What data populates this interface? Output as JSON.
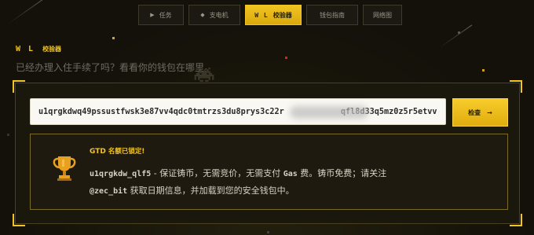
{
  "nav": {
    "tabs": [
      {
        "label": "任务",
        "icon": "▶",
        "active": false
      },
      {
        "label": "支电机",
        "icon": "◆",
        "active": false
      },
      {
        "label": "校验器",
        "icon": "W L",
        "active": true
      },
      {
        "label": "钱包指南",
        "icon": "",
        "active": false
      },
      {
        "label": "网络图",
        "icon": "",
        "active": false
      }
    ]
  },
  "brand": {
    "logo": "W L",
    "title": "校验器"
  },
  "question": "已经办理入住手续了吗？看看你的钱包在哪里。",
  "address": {
    "part1": "u1qrgkdwq49pssustfwsk3e87vv4qdc0tmtrzs3du8prys3c22r",
    "part2": "qfl8d33q5mz0z5r5etvv"
  },
  "check_button": {
    "label": "检查",
    "arrow": "→"
  },
  "notice": {
    "title_badge": "GTD",
    "title": "名额已锁定!",
    "handle": "u1qrgkdw_qlf5",
    "line1": " - 保证铸币，无需竞价，无需支付 ",
    "gas": "Gas",
    "line1_end": " 费。铸币免费；请关注",
    "twitter": "@zec_bit",
    "line2": " 获取日期信息，并加载到您的安全钱包中。"
  },
  "colors": {
    "accent": "#f2c422",
    "background": "#131109",
    "panel": "#1a170d"
  }
}
